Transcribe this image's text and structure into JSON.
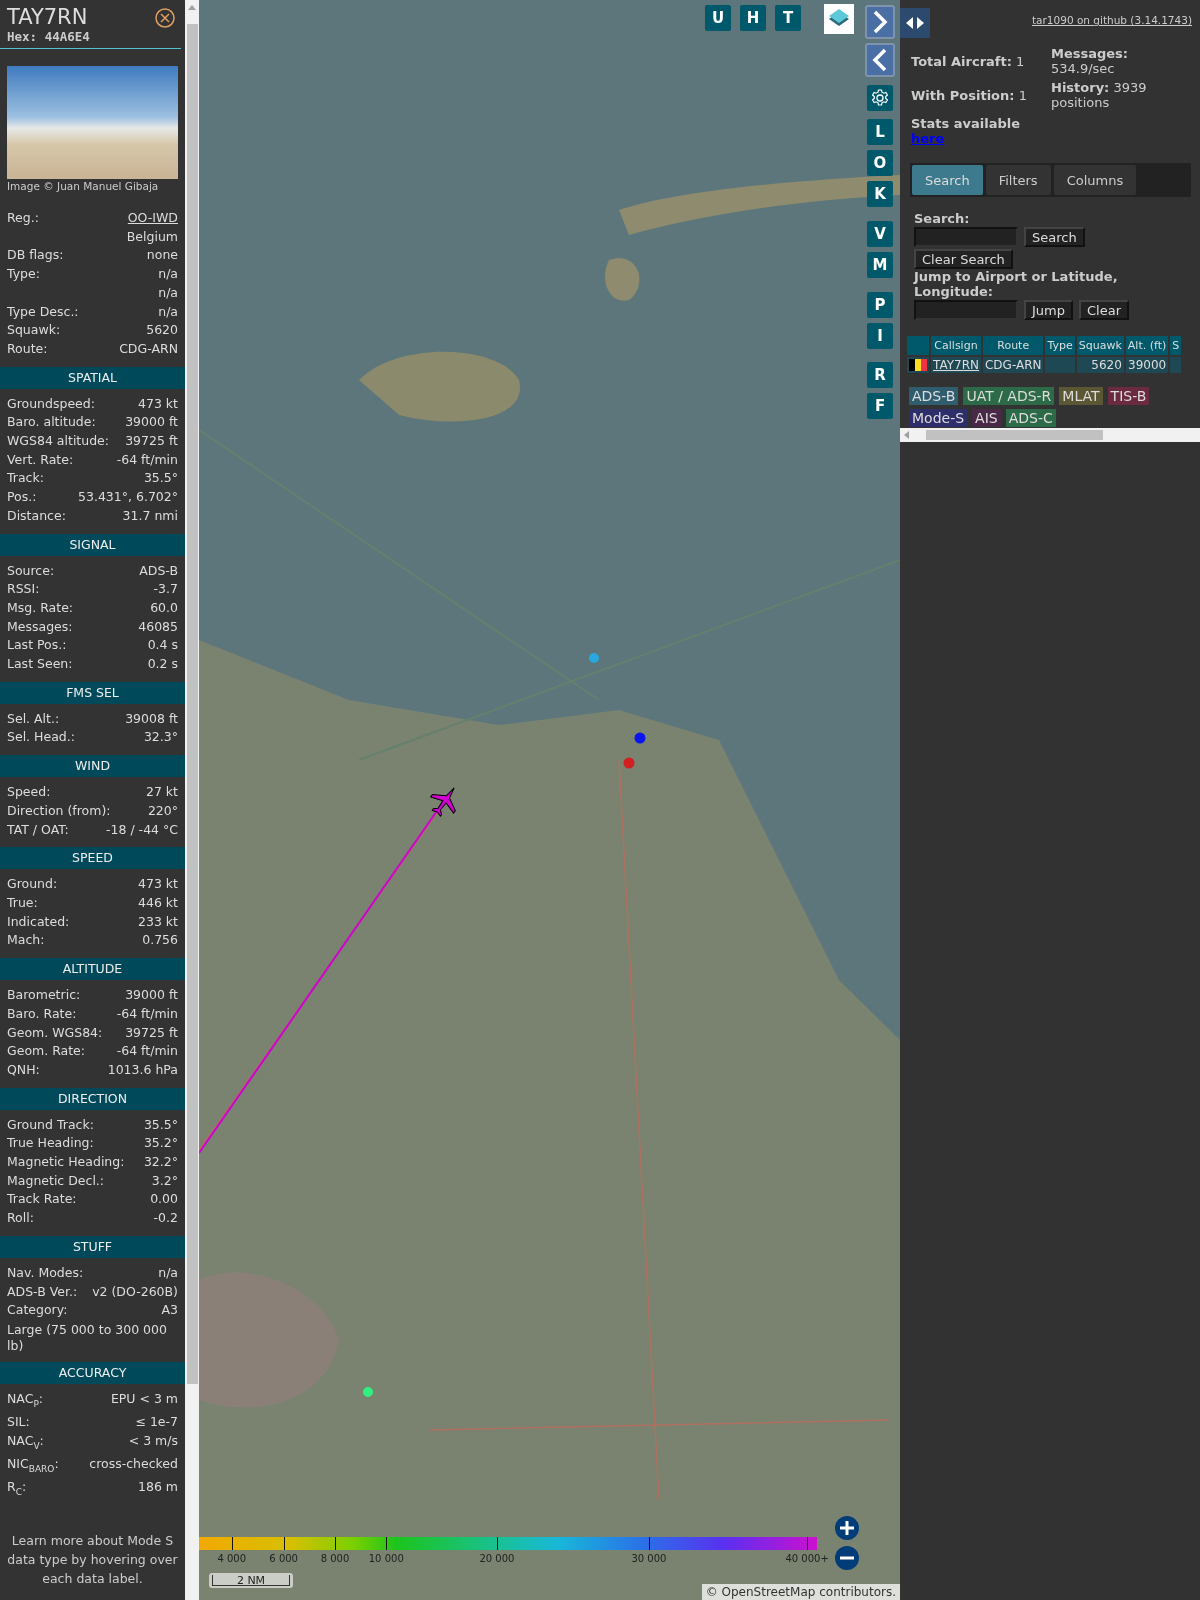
{
  "detail": {
    "callsign": "TAY7RN",
    "hex_label": "Hex:",
    "hex": "44A6E4",
    "photo_credit": "Image © Juan Manuel Gibaja",
    "rows": [
      {
        "label": "Reg.:",
        "value": "OO-IWD",
        "kind": "link"
      },
      {
        "value": "Belgium",
        "kind": "text"
      },
      {
        "label": "DB flags:",
        "value": "none",
        "kind": "text"
      },
      {
        "label": "Type:",
        "value": "n/a",
        "kind": "text"
      },
      {
        "value": "n/a",
        "kind": "text"
      },
      {
        "label": "Type Desc.:",
        "value": "n/a",
        "kind": "text"
      },
      {
        "label": "Squawk:",
        "value": "5620",
        "kind": "text"
      },
      {
        "label": "Route:",
        "value": "CDG-ARN",
        "kind": "text"
      }
    ],
    "sections": [
      {
        "title": "SPATIAL",
        "rows": [
          {
            "label": "Groundspeed:",
            "value": "473 kt",
            "kind": "text"
          },
          {
            "label": "Baro. altitude:",
            "value": "39000 ft",
            "kind": "text"
          },
          {
            "label": "WGS84 altitude:",
            "value": "39725 ft",
            "kind": "text"
          },
          {
            "label": "Vert. Rate:",
            "value": "-64 ft/min",
            "kind": "text"
          },
          {
            "label": "Track:",
            "value": "35.5°",
            "kind": "text"
          },
          {
            "label": "Pos.:",
            "value": "53.431°, 6.702°",
            "kind": "text"
          },
          {
            "label": "Distance:",
            "value": "31.7 nmi",
            "kind": "text"
          }
        ]
      },
      {
        "title": "SIGNAL",
        "rows": [
          {
            "label": "Source:",
            "value": "ADS-B",
            "kind": "text"
          },
          {
            "label": "RSSI:",
            "value": "-3.7",
            "kind": "text"
          },
          {
            "label": "Msg. Rate:",
            "value": "60.0",
            "kind": "text"
          },
          {
            "label": "Messages:",
            "value": "46085",
            "kind": "text"
          },
          {
            "label": "Last Pos.:",
            "value": "0.4 s",
            "kind": "text"
          },
          {
            "label": "Last Seen:",
            "value": "0.2 s",
            "kind": "text"
          }
        ]
      },
      {
        "title": "FMS SEL",
        "rows": [
          {
            "label": "Sel. Alt.:",
            "value": "39008 ft",
            "kind": "text"
          },
          {
            "label": "Sel. Head.:",
            "value": "32.3°",
            "kind": "text"
          }
        ]
      },
      {
        "title": "WIND",
        "rows": [
          {
            "label": "Speed:",
            "value": "27 kt",
            "kind": "text"
          },
          {
            "label": "Direction (from):",
            "value": "220°",
            "kind": "text"
          },
          {
            "label": "TAT / OAT:",
            "value": "-18 / -44 °C",
            "kind": "text"
          }
        ]
      },
      {
        "title": "SPEED",
        "rows": [
          {
            "label": "Ground:",
            "value": "473 kt",
            "kind": "text"
          },
          {
            "label": "True:",
            "value": "446 kt",
            "kind": "text"
          },
          {
            "label": "Indicated:",
            "value": "233 kt",
            "kind": "text"
          },
          {
            "label": "Mach:",
            "value": "0.756",
            "kind": "text"
          }
        ]
      },
      {
        "title": "ALTITUDE",
        "rows": [
          {
            "label": "Barometric:",
            "value": "39000 ft",
            "kind": "text"
          },
          {
            "label": "Baro. Rate:",
            "value": "-64 ft/min",
            "kind": "text"
          },
          {
            "label": "Geom. WGS84:",
            "value": "39725 ft",
            "kind": "text"
          },
          {
            "label": "Geom. Rate:",
            "value": "-64 ft/min",
            "kind": "text"
          },
          {
            "label": "QNH:",
            "value": "1013.6 hPa",
            "kind": "text"
          }
        ]
      },
      {
        "title": "DIRECTION",
        "rows": [
          {
            "label": "Ground Track:",
            "value": "35.5°",
            "kind": "text"
          },
          {
            "label": "True Heading:",
            "value": "35.2°",
            "kind": "text"
          },
          {
            "label": "Magnetic Heading:",
            "value": "32.2°",
            "kind": "text"
          },
          {
            "label": "Magnetic Decl.:",
            "value": "3.2°",
            "kind": "text"
          },
          {
            "label": "Track Rate:",
            "value": "0.00",
            "kind": "text"
          },
          {
            "label": "Roll:",
            "value": "-0.2",
            "kind": "text"
          }
        ]
      },
      {
        "title": "STUFF",
        "rows": [
          {
            "label": "Nav. Modes:",
            "value": "n/a",
            "kind": "text"
          },
          {
            "label": "ADS-B Ver.:",
            "value": "v2 (DO-260B)",
            "kind": "text"
          },
          {
            "label": "Category:",
            "value": "A3",
            "kind": "text"
          },
          {
            "value": "Large (75 000 to 300 000 lb)",
            "kind": "note"
          }
        ]
      },
      {
        "title": "ACCURACY",
        "rows": [
          {
            "label": "NAC$_{P}$:",
            "value": "EPU < 3 m",
            "kind": "text"
          },
          {
            "label": "SIL:",
            "value": "≤ 1e-7",
            "kind": "text"
          },
          {
            "label": "NAC$_{V}$:",
            "value": "< 3 m/s",
            "kind": "text"
          },
          {
            "label": "NIC$_{BARO}$:",
            "value": "cross-checked",
            "kind": "text"
          },
          {
            "label": "R$_{C}$:",
            "value": "186 m",
            "kind": "text"
          }
        ]
      }
    ],
    "footer": "Learn more about Mode S data type by hovering over each data label."
  },
  "map": {
    "top_buttons": [
      "U",
      "H",
      "T"
    ],
    "side_buttons": [
      "L",
      "O",
      "K",
      "V",
      "M",
      "P",
      "I",
      "R",
      "F"
    ],
    "legend_ticks": [
      "4 000",
      "6 000",
      "8 000",
      "10 000",
      "20 000",
      "30 000",
      "40 000+"
    ],
    "scale": "2 NM",
    "attribution_prefix": "©",
    "attribution_link": "OpenStreetMap",
    "attribution_suffix": "contributors."
  },
  "side": {
    "version_link": "tar1090 on github (3.14.1743)",
    "stats": [
      {
        "label": "Total Aircraft:",
        "value": "1"
      },
      {
        "label": "With Position:",
        "value": "1"
      },
      {
        "label": "Messages:",
        "value": "534.9/sec"
      },
      {
        "label": "History:",
        "value": "3939 positions"
      }
    ],
    "stats_note": "Stats available",
    "stats_link": "here",
    "tabs": [
      {
        "label": "Search",
        "selected": true
      },
      {
        "label": "Filters",
        "selected": false
      },
      {
        "label": "Columns",
        "selected": false
      }
    ],
    "search_label": "Search:",
    "search_button": "Search",
    "clear_search_button": "Clear Search",
    "jump_label": "Jump to Airport or Latitude, Longitude:",
    "jump_button": "Jump",
    "clear_button": "Clear",
    "table": {
      "columns": [
        "Callsign",
        "Route",
        "Type",
        "Squawk",
        "Alt. (ft)",
        "S"
      ],
      "rows": [
        {
          "selected": true,
          "callsign": "TAY7RN",
          "route": "CDG-ARN",
          "squawk": "5620",
          "altitude": "39000"
        }
      ]
    },
    "sources": [
      {
        "label": "ADS-B",
        "color": "#2f5d6e"
      },
      {
        "label": "UAT / ADS-R",
        "color": "#2d6a48"
      },
      {
        "label": "MLAT",
        "color": "#5b5634"
      },
      {
        "label": "TIS-B",
        "color": "#6a2a40"
      },
      {
        "label": "Mode-S",
        "color": "#2e2f6a"
      },
      {
        "label": "AIS",
        "color": "#4a2848"
      },
      {
        "label": "ADS-C",
        "color": "#2d6a48"
      }
    ]
  }
}
